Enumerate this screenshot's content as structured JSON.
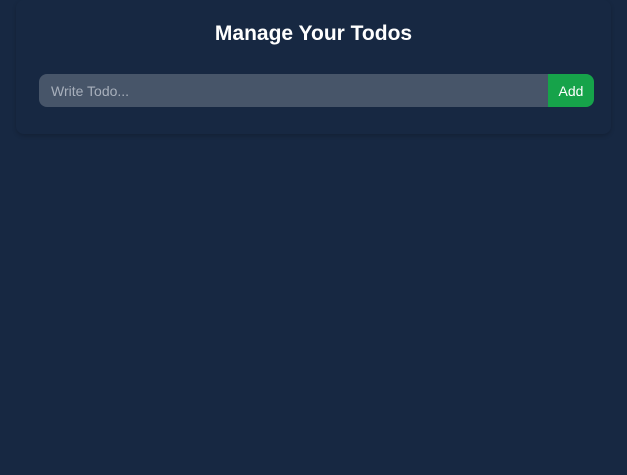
{
  "header": {
    "title": "Manage Your Todos"
  },
  "form": {
    "input_value": "",
    "input_placeholder": "Write Todo...",
    "add_label": "Add"
  },
  "todos": [],
  "colors": {
    "background": "#172842",
    "input_background": "#475569",
    "add_button": "#16a34a",
    "text": "#ffffff"
  }
}
